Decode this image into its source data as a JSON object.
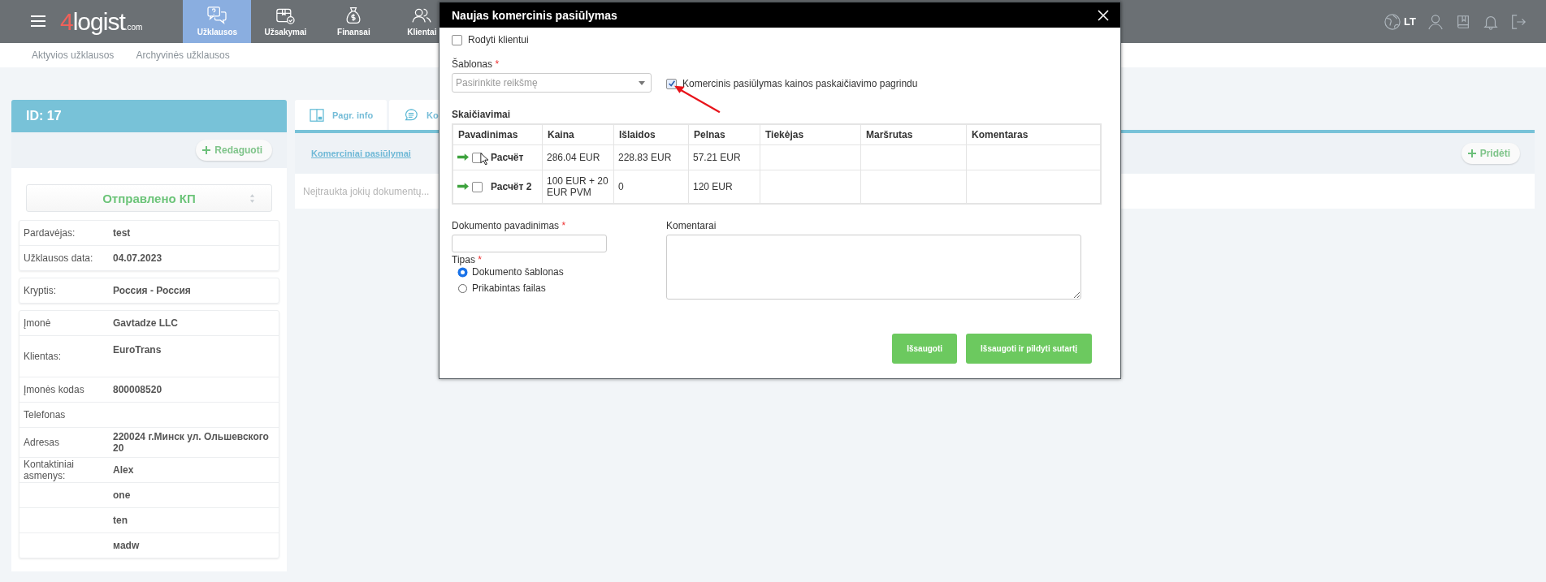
{
  "nav": {
    "brand_digit": "4",
    "brand": "logist",
    "brand_suffix": ".com",
    "language": "LT",
    "items": [
      {
        "label": "Užklausos",
        "kind": "chat",
        "selected": true
      },
      {
        "label": "Užsakymai",
        "kind": "box",
        "selected": false
      },
      {
        "label": "Finansai",
        "kind": "money",
        "selected": false
      },
      {
        "label": "Klientai",
        "kind": "people",
        "selected": false
      }
    ]
  },
  "subnav": [
    {
      "label": "Aktyvios užklausos"
    },
    {
      "label": "Archyvinės užklausos"
    }
  ],
  "request": {
    "id": "ID: 17",
    "edit_button": "Redaguoti",
    "status": "Отправлено КП",
    "groups": [
      [
        {
          "label": "Pardavėjas:",
          "value": "test"
        },
        {
          "label": "Užklausos data:",
          "value": "04.07.2023"
        }
      ],
      [
        {
          "label": "Kryptis:",
          "value": "Россия - Россия"
        }
      ],
      [
        {
          "label": "Įmonė",
          "value": "Gavtadze LLC"
        },
        {
          "label": "Klientas:",
          "value": "EuroTrans",
          "kind": "tall"
        },
        {
          "label": "Įmonės kodas",
          "value": "800008520"
        },
        {
          "label": "Telefonas"
        },
        {
          "label": "Adresas",
          "value": "220024 г.Минск ул. Ольшевского 20"
        },
        {
          "label": "Kontaktiniai asmenys:",
          "value": "Alex"
        },
        {
          "value": "one"
        },
        {
          "value": "ten"
        },
        {
          "value": "мadw"
        }
      ]
    ]
  },
  "tabs": [
    {
      "label": "Pagr. info",
      "kind": "panel"
    },
    {
      "label": "Ko",
      "kind": "chat"
    }
  ],
  "section_link": "Komerciniai pasiūlymai",
  "add_button": "Pridėti",
  "empty_text": "Neįtraukta jokių dokumentų...",
  "modal": {
    "title": "Naujas komercinis pasiūlymas",
    "show_client": {
      "label": "Rodyti klientui",
      "checked": false
    },
    "template": {
      "label": "Šablonas",
      "required_mark": "*",
      "placeholder": "Pasirinkite reikšmę"
    },
    "price_based": {
      "label": "Komercinis pasiūlymas kainos paskaičiavimo pagrindu",
      "checked": true
    },
    "calculations": {
      "title": "Skaičiavimai",
      "columns": [
        "Pavadinimas",
        "Kaina",
        "Išlaidos",
        "Pelnas",
        "Tiekėjas",
        "Maršrutas",
        "Komentaras"
      ],
      "rows": [
        {
          "checked": false,
          "cells": [
            "Расчёт",
            "286.04 EUR",
            "228.83 EUR",
            "57.21 EUR",
            "",
            "",
            ""
          ]
        },
        {
          "checked": false,
          "cells": [
            "Расчёт 2",
            "100 EUR + 20 EUR PVM",
            "0",
            "120 EUR",
            "",
            "",
            ""
          ]
        }
      ]
    },
    "document_name": {
      "label": "Dokumento pavadinimas",
      "required_mark": "*"
    },
    "comments": {
      "label": "Komentarai"
    },
    "type": {
      "label": "Tipas",
      "required_mark": "*",
      "options": [
        {
          "label": "Dokumento šablonas",
          "selected": true
        },
        {
          "label": "Prikabintas failas",
          "selected": false
        }
      ]
    },
    "buttons": [
      "Išsaugoti",
      "Išsaugoti ir pildyti sutartį"
    ]
  }
}
